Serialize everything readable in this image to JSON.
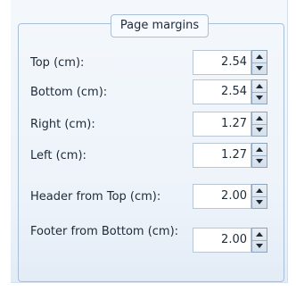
{
  "group": {
    "title": "Page margins"
  },
  "fields": [
    {
      "label": "Top (cm):",
      "value": "2.54"
    },
    {
      "label": "Bottom (cm):",
      "value": "2.54"
    },
    {
      "label": "Right (cm):",
      "value": "1.27"
    },
    {
      "label": "Left (cm):",
      "value": "1.27"
    },
    {
      "label": "Header from Top (cm):",
      "value": "2.00"
    },
    {
      "label": "Footer from Bottom (cm):",
      "value": "2.00"
    }
  ],
  "icons": {
    "increment": "chevron-up-icon",
    "decrement": "chevron-down-icon"
  },
  "colors": {
    "panel_background": "#edf3fa",
    "frame_border": "#a9bfd8",
    "text": "#1e2a36"
  }
}
